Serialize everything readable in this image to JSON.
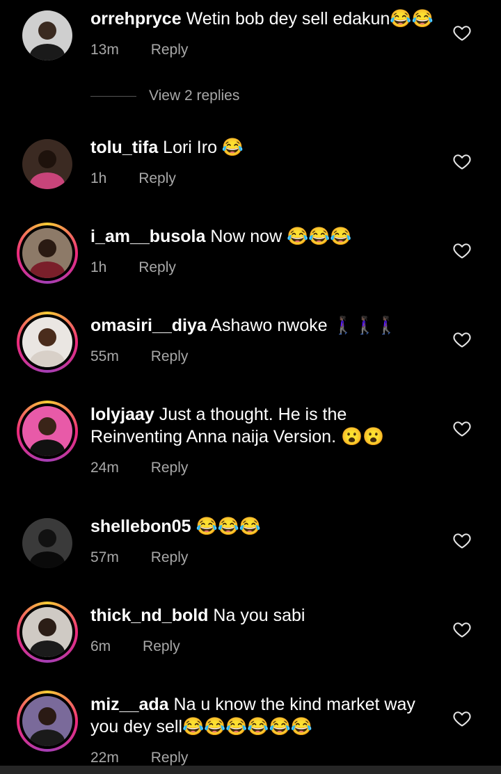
{
  "comments": [
    {
      "username": "orrehpryce",
      "text": "Wetin bob dey sell edakun😂😂",
      "time": "13m",
      "reply": "Reply"
    },
    {
      "username": "tolu_tifa",
      "text": "Lori Iro 😂",
      "time": "1h",
      "reply": "Reply"
    },
    {
      "username": "i_am__busola",
      "text": "Now now 😂😂😂",
      "time": "1h",
      "reply": "Reply"
    },
    {
      "username": "omasiri__diya",
      "text": "Ashawo nwoke 🚶🏿‍♀️🚶🏿‍♀️🚶🏿‍♀️",
      "time": "55m",
      "reply": "Reply"
    },
    {
      "username": "lolyjaay",
      "text": "Just a thought. He is the Reinventing Anna naija Version. 😮😮",
      "time": "24m",
      "reply": "Reply"
    },
    {
      "username": "shellebon05",
      "text": "😂😂😂",
      "time": "57m",
      "reply": "Reply"
    },
    {
      "username": "thick_nd_bold",
      "text": "Na you sabi",
      "time": "6m",
      "reply": "Reply"
    },
    {
      "username": "miz__ada",
      "text": "Na u know the kind market way you dey sell😂😂😂😂😂😂",
      "time": "22m",
      "reply": "Reply"
    }
  ],
  "view_replies": "View 2 replies",
  "colors": {
    "background": "#000000",
    "secondary_text": "#a8a8a8",
    "story_ring_start": "#f9ce34",
    "story_ring_end": "#ee2a7b"
  },
  "icons": {
    "like": "heart-outline-icon"
  }
}
